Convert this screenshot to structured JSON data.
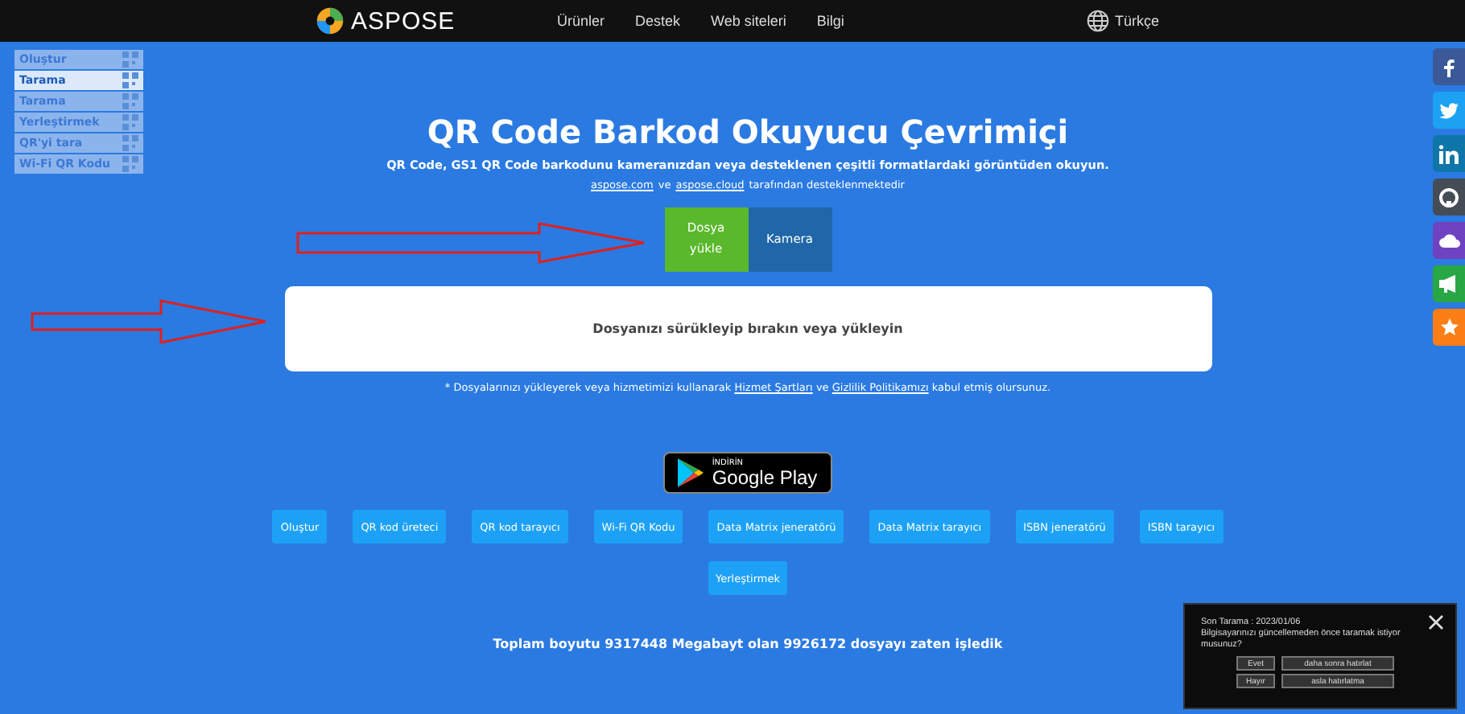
{
  "header": {
    "logo": "ASPOSE",
    "nav": [
      "Ürünler",
      "Destek",
      "Web siteleri",
      "Bilgi"
    ],
    "language": "Türkçe"
  },
  "sidebar": {
    "items": [
      {
        "label": "Oluştur",
        "selected": false
      },
      {
        "label": "Tarama",
        "selected": true
      },
      {
        "label": "Tarama",
        "selected": false
      },
      {
        "label": "Yerleştirmek",
        "selected": false
      },
      {
        "label": "QR'yi tara",
        "selected": false
      },
      {
        "label": "Wi-Fi QR Kodu",
        "selected": false
      }
    ]
  },
  "title": "QR Code Barkod Okuyucu Çevrimiçi",
  "subtitle": "QR Code, GS1 QR Code barkodunu kameranızdan veya desteklenen çeşitli formatlardaki görüntüden okuyun.",
  "support": {
    "links": [
      "aspose.com",
      "aspose.cloud"
    ],
    "joiner": "ve",
    "suffix": "tarafından desteklenmektedir"
  },
  "tabs": [
    {
      "label": "Dosya yükle",
      "selected": true
    },
    {
      "label": "Kamera",
      "selected": false
    }
  ],
  "dropzone": "Dosyanızı sürükleyip bırakın veya yükleyin",
  "terms": {
    "before": "* Dosyalarınızı yükleyerek veya hizmetimizi kullanarak",
    "link1": "Hizmet Şartları",
    "joiner": "ve",
    "link2": "Gizlilik Politikamızı",
    "after": "kabul etmiş olursunuz."
  },
  "store": {
    "small": "İNDİRİN",
    "big": "Google Play"
  },
  "tools": [
    "Oluştur",
    "QR kod üreteci",
    "QR kod tarayıcı",
    "Wi-Fi QR Kodu",
    "Data Matrix jeneratörü",
    "Data Matrix tarayıcı",
    "ISBN jeneratörü",
    "ISBN tarayıcı",
    "Yerleştirmek"
  ],
  "stats": "Toplam boyutu 9317448 Megabayt olan 9926172 dosyayı zaten işledik",
  "social": [
    {
      "kind": "facebook",
      "color": "#3b5998"
    },
    {
      "kind": "twitter",
      "color": "#1da1f2"
    },
    {
      "kind": "linkedin",
      "color": "#0e76a8"
    },
    {
      "kind": "github",
      "color": "#444c56"
    },
    {
      "kind": "cloud",
      "color": "#6f42c1"
    },
    {
      "kind": "megaphone",
      "color": "#28a745"
    },
    {
      "kind": "star",
      "color": "#fd7e14"
    }
  ],
  "popup": {
    "line1": "Son Tarama : 2023/01/06",
    "line2": "Bilgisayarınızı güncellemeden önce taramak istiyor musunuz?",
    "buttons": [
      "Evet",
      "daha sonra hatırlat",
      "Hayır",
      "asla hatırlatma"
    ]
  }
}
